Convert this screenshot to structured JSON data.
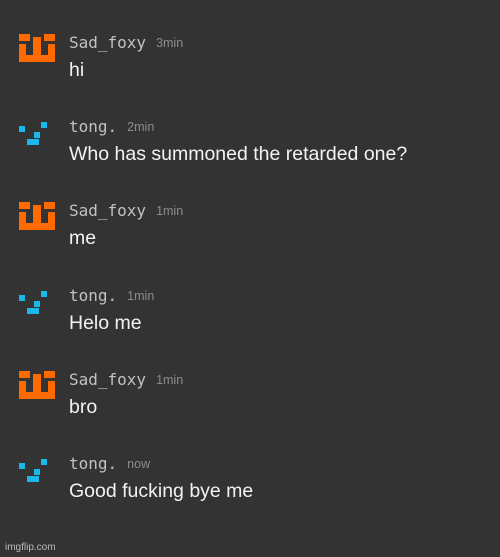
{
  "colors": {
    "background": "#333333",
    "username": "#c2c2c2",
    "timestamp": "#8c8c8c",
    "message_text": "#f2f2f2",
    "sad_foxy_avatar": "#ff6a00",
    "tong_avatar": "#1ab7ea"
  },
  "messages": [
    {
      "user": "Sad_foxy",
      "time": "3min",
      "text": "hi",
      "avatar_icon": "orange-pixel-face-icon"
    },
    {
      "user": "tong.",
      "time": "2min",
      "text": "Who has summoned the retarded one?",
      "avatar_icon": "blue-pixel-checkmark-icon"
    },
    {
      "user": "Sad_foxy",
      "time": "1min",
      "text": "me",
      "avatar_icon": "orange-pixel-face-icon"
    },
    {
      "user": "tong.",
      "time": "1min",
      "text": "Helo me",
      "avatar_icon": "blue-pixel-checkmark-icon"
    },
    {
      "user": "Sad_foxy",
      "time": "1min",
      "text": "bro",
      "avatar_icon": "orange-pixel-face-icon"
    },
    {
      "user": "tong.",
      "time": "now",
      "text": "Good fucking bye me",
      "avatar_icon": "blue-pixel-checkmark-icon"
    }
  ],
  "watermark": "imgflip.com"
}
